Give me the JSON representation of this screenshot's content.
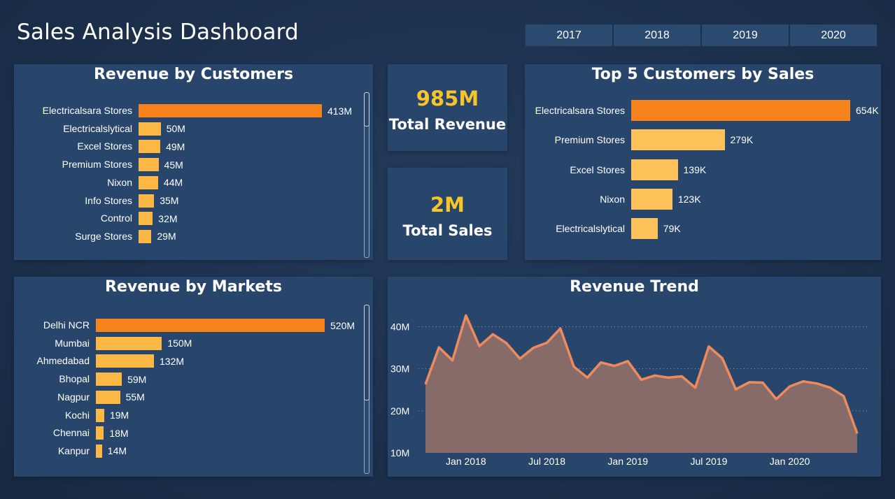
{
  "header": {
    "title": "Sales Analysis Dashboard"
  },
  "years": [
    "2017",
    "2018",
    "2019",
    "2020"
  ],
  "colors": {
    "highlight": "#f7821b",
    "bar": "#fdb745",
    "bar_light": "#fdc35a",
    "kpi": "#f7c52a",
    "trend_line": "#ed8a5e",
    "trend_fill": "#876b68"
  },
  "kpis": {
    "revenue": {
      "value": "985M",
      "label": "Total Revenue"
    },
    "sales": {
      "value": "2M",
      "label": "Total Sales"
    }
  },
  "chart_data": [
    {
      "id": "revenue_by_customers",
      "type": "bar",
      "orientation": "horizontal",
      "title": "Revenue by Customers",
      "categories": [
        "Electricalsara Stores",
        "Electricalslytical",
        "Excel Stores",
        "Premium Stores",
        "Nixon",
        "Info Stores",
        "Control",
        "Surge Stores"
      ],
      "values": [
        413,
        50,
        49,
        45,
        44,
        35,
        32,
        29
      ],
      "labels": [
        "413M",
        "50M",
        "49M",
        "45M",
        "44M",
        "35M",
        "32M",
        "29M"
      ],
      "unit": "M"
    },
    {
      "id": "top5_customers_by_sales",
      "type": "bar",
      "orientation": "horizontal",
      "title": "Top 5 Customers by Sales",
      "categories": [
        "Electricalsara Stores",
        "Premium Stores",
        "Excel Stores",
        "Nixon",
        "Electricalslytical"
      ],
      "values": [
        654,
        279,
        139,
        123,
        79
      ],
      "labels": [
        "654K",
        "279K",
        "139K",
        "123K",
        "79K"
      ],
      "unit": "K"
    },
    {
      "id": "revenue_by_markets",
      "type": "bar",
      "orientation": "horizontal",
      "title": "Revenue by Markets",
      "categories": [
        "Delhi NCR",
        "Mumbai",
        "Ahmedabad",
        "Bhopal",
        "Nagpur",
        "Kochi",
        "Chennai",
        "Kanpur"
      ],
      "values": [
        520,
        150,
        132,
        59,
        55,
        19,
        18,
        14
      ],
      "labels": [
        "520M",
        "150M",
        "132M",
        "59M",
        "55M",
        "19M",
        "18M",
        "14M"
      ],
      "unit": "M"
    },
    {
      "id": "revenue_trend",
      "type": "area",
      "title": "Revenue Trend",
      "x_start": "2017-10",
      "x": [
        "2017-10",
        "2017-11",
        "2017-12",
        "2018-01",
        "2018-02",
        "2018-03",
        "2018-04",
        "2018-05",
        "2018-06",
        "2018-07",
        "2018-08",
        "2018-09",
        "2018-10",
        "2018-11",
        "2018-12",
        "2019-01",
        "2019-02",
        "2019-03",
        "2019-04",
        "2019-05",
        "2019-06",
        "2019-07",
        "2019-08",
        "2019-09",
        "2019-10",
        "2019-11",
        "2019-12",
        "2020-01",
        "2020-02",
        "2020-03",
        "2020-04",
        "2020-05",
        "2020-06"
      ],
      "values": [
        26.3,
        35.1,
        32.0,
        42.7,
        35.4,
        38.2,
        36.1,
        32.4,
        35.0,
        36.2,
        39.6,
        30.5,
        27.9,
        31.5,
        30.7,
        31.8,
        27.4,
        28.4,
        27.9,
        28.2,
        25.5,
        35.3,
        32.5,
        25.1,
        26.8,
        26.7,
        22.8,
        25.8,
        27.0,
        26.5,
        25.5,
        23.5,
        14.6
      ],
      "ylim": [
        10,
        45
      ],
      "y_ticks": [
        "10M",
        "20M",
        "30M",
        "40M"
      ],
      "y_tick_values": [
        10,
        20,
        30,
        40
      ],
      "x_ticks": [
        "Jan 2018",
        "Jul 2018",
        "Jan 2019",
        "Jul 2019",
        "Jan 2020"
      ],
      "x_tick_values": [
        "2018-01",
        "2018-07",
        "2019-01",
        "2019-07",
        "2020-01"
      ],
      "grid": true
    }
  ]
}
